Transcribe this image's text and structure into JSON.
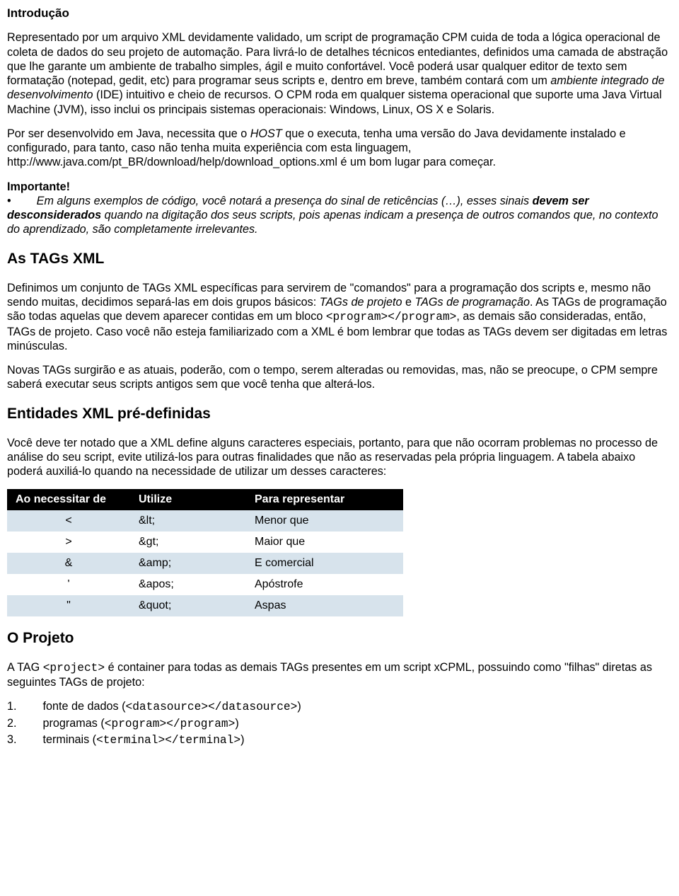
{
  "h_intro": "Introdução",
  "p_intro": "Representado por um arquivo XML devidamente validado, um script de programação CPM cuida de toda a lógica operacional de coleta de dados do seu projeto de automação. Para livrá-lo de detalhes técnicos entediantes, definidos uma camada de abstração que lhe garante um ambiente de trabalho simples, ágil e muito confortável. Você poderá usar qualquer editor de texto sem formatação (notepad, gedit, etc) para programar seus scripts e, dentro em breve, também contará com um ",
  "p_intro_i1": "ambiente integrado de desenvolvimento",
  "p_intro_2": " (IDE) intuitivo e cheio de recursos. O CPM roda em qualquer sistema operacional que suporte uma Java Virtual Machine (JVM), isso inclui os principais sistemas operacionais: Windows, Linux, OS X e Solaris.",
  "p_java1": "Por ser desenvolvido em Java, necessita que o ",
  "p_java_h": "HOST",
  "p_java2": " que o executa, tenha uma versão do Java devidamente instalado e configurado, para tanto, caso não tenha muita experiência com esta linguagem, http://www.java.com/pt_BR/download/help/download_options.xml é um bom lugar para começar.",
  "imp_label": "Importante!",
  "imp_bullet": "•",
  "imp_i1": "Em alguns exemplos de código, você notará a presença do sinal de reticências (…), esses sinais ",
  "imp_b": "devem ser desconsiderados",
  "imp_i2": " quando na digitação dos seus scripts, pois apenas indicam a presença de outros comandos que, no contexto do aprendizado, são completamente irrelevantes.",
  "h_tags": "As TAGs XML",
  "p_tags1a": "Definimos um conjunto de TAGs XML específicas para servirem de \"comandos\" para a programação dos scripts e, mesmo não sendo muitas, decidimos separá-las em dois grupos básicos: ",
  "p_tags1b": "TAGs de projeto",
  "p_tags1c": " e ",
  "p_tags1d": "TAGs de programação",
  "p_tags1e": ". As TAGs de programação são todas aquelas que devem aparecer contidas em um bloco ",
  "p_tags_code": "<program></program>",
  "p_tags1f": ", as demais são consideradas, então, TAGs de projeto. Caso você não esteja familiarizado com a XML é bom lembrar que todas as TAGs devem ser digitadas em letras minúsculas.",
  "p_tags2": "Novas TAGs surgirão e as atuais, poderão, com o tempo, serem alteradas ou removidas,  mas, não se preocupe, o CPM sempre saberá executar seus scripts antigos sem que você tenha que alterá-los.",
  "h_ent": "Entidades XML pré-definidas",
  "p_ent": "Você deve ter notado que a XML define alguns caracteres especiais, portanto, para que não ocorram problemas no processo de análise do seu script, evite utilizá-los para outras finalidades que não as reservadas pela própria linguagem. A tabela abaixo poderá auxiliá-lo quando na necessidade de utilizar um desses caracteres:",
  "tbl": {
    "h0": "Ao necessitar de",
    "h1": "Utilize",
    "h2": "Para representar",
    "rows": [
      {
        "c0": "<",
        "c1": "&lt;",
        "c2": "Menor que"
      },
      {
        "c0": ">",
        "c1": "&gt;",
        "c2": "Maior que"
      },
      {
        "c0": "&",
        "c1": "&amp;",
        "c2": "E comercial"
      },
      {
        "c0": "'",
        "c1": "&apos;",
        "c2": "Apóstrofe"
      },
      {
        "c0": "\"",
        "c1": "&quot;",
        "c2": "Aspas"
      }
    ]
  },
  "h_proj": "O Projeto",
  "p_proj_a": "A TAG ",
  "p_proj_code": "<project>",
  "p_proj_b": " é container para todas as demais TAGs presentes em um script xCPML, possuindo como \"filhas\" diretas as seguintes TAGs de projeto:",
  "li1n": "1.",
  "li1a": "fonte de dados (",
  "li1c": "<datasource></datasource>",
  "li1b": ")",
  "li2n": "2.",
  "li2a": "programas (",
  "li2c": "<program></program>",
  "li2b": ")",
  "li3n": "3.",
  "li3a": "terminais (",
  "li3c": "<terminal></terminal>",
  "li3b": ")"
}
